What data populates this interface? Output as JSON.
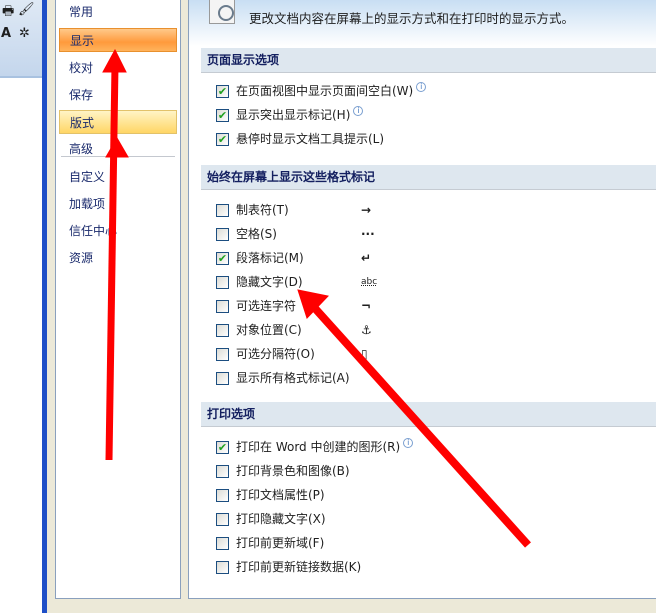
{
  "nav": {
    "items": [
      {
        "label": "常用"
      },
      {
        "label": "显示",
        "selected": true
      },
      {
        "label": "校对"
      },
      {
        "label": "保存"
      },
      {
        "label": "版式",
        "hover": true
      },
      {
        "label": "高级"
      },
      {
        "label": "自定义"
      },
      {
        "label": "加载项"
      },
      {
        "label": "信任中心"
      },
      {
        "label": "资源"
      }
    ]
  },
  "header": {
    "description": "更改文档内容在屏幕上的显示方式和在打印时的显示方式。"
  },
  "sections": [
    {
      "title": "页面显示选项",
      "options": [
        {
          "label": "在页面视图中显示页面间空白(W)",
          "checked": true,
          "info": true
        },
        {
          "label": "显示突出显示标记(H)",
          "checked": true,
          "info": true
        },
        {
          "label": "悬停时显示文档工具提示(L)",
          "checked": true
        }
      ]
    },
    {
      "title": "始终在屏幕上显示这些格式标记",
      "options": [
        {
          "label": "制表符(T)",
          "checked": false,
          "symbol": "→"
        },
        {
          "label": "空格(S)",
          "checked": false,
          "symbol": "···"
        },
        {
          "label": "段落标记(M)",
          "checked": true,
          "symbol": "↵"
        },
        {
          "label": "隐藏文字(D)",
          "checked": false,
          "symbol": "abc"
        },
        {
          "label": "可选连字符",
          "checked": false,
          "symbol": "¬"
        },
        {
          "label": "对象位置(C)",
          "checked": false,
          "symbol": "⚓"
        },
        {
          "label": "可选分隔符(O)",
          "checked": false,
          "symbol": "▯"
        },
        {
          "label": "显示所有格式标记(A)",
          "checked": false
        }
      ]
    },
    {
      "title": "打印选项",
      "options": [
        {
          "label": "打印在 Word 中创建的图形(R)",
          "checked": true,
          "info": true
        },
        {
          "label": "打印背景色和图像(B)",
          "checked": false
        },
        {
          "label": "打印文档属性(P)",
          "checked": false
        },
        {
          "label": "打印隐藏文字(X)",
          "checked": false
        },
        {
          "label": "打印前更新域(F)",
          "checked": false
        },
        {
          "label": "打印前更新链接数据(K)",
          "checked": false
        }
      ]
    }
  ],
  "colors": {
    "annotation_arrow": "#ff0000",
    "selected_nav": "#ff9a3c"
  }
}
